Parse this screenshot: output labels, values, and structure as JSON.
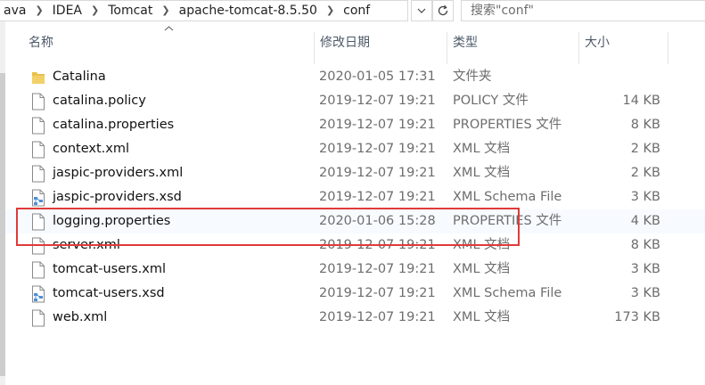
{
  "address": {
    "crumbs": [
      "ava",
      "IDEA",
      "Tomcat",
      "apache-tomcat-8.5.50",
      "conf"
    ],
    "dropdown_icon": "chevron-down-icon",
    "refresh_icon": "refresh-icon",
    "search_placeholder": "搜索\"conf\""
  },
  "columns": {
    "name": "名称",
    "date": "修改日期",
    "type": "类型",
    "size": "大小"
  },
  "files": [
    {
      "name": "Catalina",
      "date": "2020-01-05 17:31",
      "type": "文件夹",
      "size": "",
      "icon": "folder-icon"
    },
    {
      "name": "catalina.policy",
      "date": "2019-12-07 19:21",
      "type": "POLICY 文件",
      "size": "14 KB",
      "icon": "file-icon"
    },
    {
      "name": "catalina.properties",
      "date": "2019-12-07 19:21",
      "type": "PROPERTIES 文件",
      "size": "8 KB",
      "icon": "file-icon"
    },
    {
      "name": "context.xml",
      "date": "2019-12-07 19:21",
      "type": "XML 文档",
      "size": "2 KB",
      "icon": "file-icon"
    },
    {
      "name": "jaspic-providers.xml",
      "date": "2019-12-07 19:21",
      "type": "XML 文档",
      "size": "2 KB",
      "icon": "file-icon"
    },
    {
      "name": "jaspic-providers.xsd",
      "date": "2019-12-07 19:21",
      "type": "XML Schema File",
      "size": "3 KB",
      "icon": "xsd-file-icon"
    },
    {
      "name": "logging.properties",
      "date": "2020-01-06 15:28",
      "type": "PROPERTIES 文件",
      "size": "4 KB",
      "icon": "file-icon",
      "selected": true
    },
    {
      "name": "server.xml",
      "date": "2019-12-07 19:21",
      "type": "XML 文档",
      "size": "8 KB",
      "icon": "file-icon"
    },
    {
      "name": "tomcat-users.xml",
      "date": "2019-12-07 19:21",
      "type": "XML 文档",
      "size": "3 KB",
      "icon": "file-icon"
    },
    {
      "name": "tomcat-users.xsd",
      "date": "2019-12-07 19:21",
      "type": "XML Schema File",
      "size": "3 KB",
      "icon": "xsd-file-icon"
    },
    {
      "name": "web.xml",
      "date": "2019-12-07 19:21",
      "type": "XML 文档",
      "size": "173 KB",
      "icon": "file-icon"
    }
  ],
  "colors": {
    "highlight_border": "#e03a3a",
    "folder": "#e8c04a",
    "selected_row": "#f7fbff"
  }
}
